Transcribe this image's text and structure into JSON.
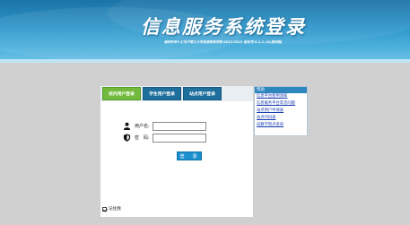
{
  "header": {
    "title": "信息服务系统登录",
    "subtitle": "版权所有©汇东沪联工大学信息教育学院 2013-2022 版本号:5.1.1.10(测试版)"
  },
  "login_panel": {
    "tabs": [
      {
        "label": "校内用户登录",
        "active": true
      },
      {
        "label": "学生用户登录",
        "active": false
      },
      {
        "label": "站点用户登录",
        "active": false
      }
    ],
    "username_label": "用户名:",
    "username_value": "",
    "password_label": "密　码:",
    "password_value": "",
    "login_button": "登　录",
    "remember_label": "记住我",
    "remember_checked": true
  },
  "sidebar": {
    "heading": "帮助",
    "links": [
      "信息平台使用须知",
      "信息服务平台常见问题",
      "站点用户申请表",
      "站点代码表",
      "成教学院点查询"
    ]
  },
  "colors": {
    "banner_top": "#1b73a6",
    "banner_bottom": "#6cc2e6",
    "tab_active": "#72b93e",
    "tab_inactive": "#1e6f9c",
    "button": "#1c8fcf",
    "link": "#1a3fb3",
    "page_bg": "#d0d0d0"
  },
  "icons": {
    "username": "user-icon",
    "password": "shield-icon"
  }
}
